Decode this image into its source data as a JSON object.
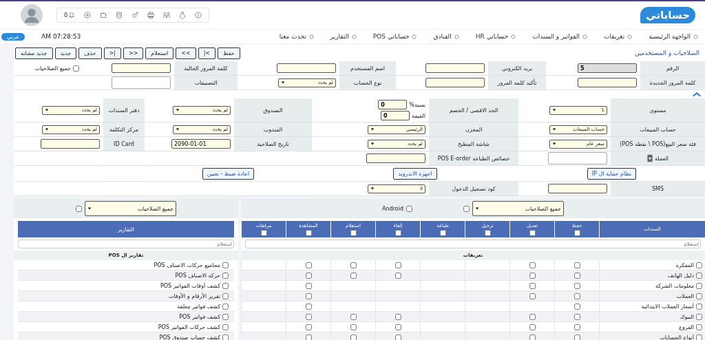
{
  "header": {
    "logo": "حساباتي",
    "notifications_count": "0"
  },
  "nav": {
    "items": [
      "الواجهة الرئيسية",
      "تعريفات",
      "الفواتير و السندات",
      "حساباتي HR",
      "الفنادق",
      "حساباتي POS",
      "التقارير",
      "تحدث معنا"
    ],
    "time": "AM 07:28:53",
    "language": "عربي"
  },
  "page_title": "الصلاحيات و المستخدمين",
  "actions": [
    "حفظ",
    "|<",
    "<<",
    "استعلام",
    ">>",
    ">|",
    "حذف",
    "جديد",
    "جديد مشابه"
  ],
  "account": {
    "rows": [
      [
        {
          "label": "الرقم",
          "field": {
            "kind": "readonly",
            "value": "5"
          }
        },
        {
          "label": "بريد الكتروني",
          "field": {
            "kind": "input"
          }
        },
        {
          "label": "اسم المستخدم",
          "field": {
            "kind": "input"
          }
        },
        {
          "label": "كلمة المرور الحالية",
          "field": {
            "kind": "input"
          }
        },
        {
          "label": "جميع الصلاحيات",
          "field": {
            "kind": "checkbox",
            "checked": false
          }
        }
      ],
      [
        {
          "label": "كلمة المرور الجديدة",
          "field": {
            "kind": "input"
          }
        },
        {
          "label": "تأكيد كلمة المرور",
          "field": {
            "kind": "input"
          }
        },
        {
          "label": "نوع الحساب",
          "field": {
            "kind": "select",
            "value": "لم يحدد"
          }
        },
        {
          "label": "التصنيفات",
          "field": {
            "kind": "plain"
          }
        },
        {
          "kind": "empty"
        }
      ]
    ]
  },
  "settings": {
    "rows": [
      [
        {
          "label": "مستوى",
          "field": {
            "kind": "select",
            "value": "1"
          }
        },
        {
          "label": "الحد الاقصى / الخصم",
          "field": {
            "kind": "pair",
            "items": [
              {
                "label": "نسبة%",
                "value": "0"
              },
              {
                "label": "القيمة",
                "value": "0"
              }
            ]
          }
        },
        {
          "label": "الصندوق",
          "field": {
            "kind": "select",
            "value": "لم يحدد"
          }
        },
        {
          "label": "دفتر السندات",
          "field": {
            "kind": "select",
            "value": "لم يحدد"
          }
        }
      ],
      [
        {
          "label": "حساب المبيعات",
          "field": {
            "kind": "select",
            "value": "حساب المبيعات"
          }
        },
        {
          "label": "المخزن",
          "field": {
            "kind": "select",
            "value": "الرئيسي"
          }
        },
        {
          "label": "المندوب",
          "field": {
            "kind": "select",
            "value": "لم يحدد"
          }
        },
        {
          "label": "مركز التكلفة",
          "field": {
            "kind": "select",
            "value": "لم يحدد"
          }
        }
      ],
      [
        {
          "label": "فئة سعر البيع(POS \\ نقطة POS)",
          "field": {
            "kind": "select",
            "value": "سعر عام"
          }
        },
        {
          "label": "شاشة المطبخ",
          "field": {
            "kind": "select",
            "value": "لم يحدد"
          }
        },
        {
          "label": "تاريخ الصلاحية",
          "field": {
            "kind": "input",
            "value": "2090-01-01"
          }
        },
        {
          "label": "ID Card",
          "field": {
            "kind": "input"
          }
        }
      ],
      [
        {
          "label": "العملة",
          "kind": "icon-label",
          "field": {
            "kind": "plain"
          }
        },
        {
          "label": "خصائص الطباعة POS E-order",
          "field": {
            "kind": "input"
          }
        },
        {
          "kind": "empty"
        },
        {
          "kind": "empty"
        }
      ],
      [
        {
          "field": {
            "kind": "button",
            "label": "نظام حماية ال IP"
          }
        },
        {
          "field": {
            "kind": "button",
            "label": "اجهزة الاندرويد"
          }
        },
        {
          "field": {
            "kind": "button",
            "label": "اعادة ضبط - تعيين"
          }
        },
        {
          "kind": "empty"
        }
      ],
      [
        {
          "label": "SMS",
          "field": {
            "kind": "input"
          }
        },
        {
          "label": "كود تسجيل الدخول",
          "field": {
            "kind": "select",
            "value": "لا"
          }
        },
        {
          "kind": "empty"
        },
        {
          "kind": "empty"
        }
      ]
    ]
  },
  "vouchers_panel": {
    "filter": "جميع الصلاحيات",
    "all_checked": false,
    "android": {
      "label": "Android",
      "checked": false
    },
    "columns": [
      {
        "label": "السندات"
      },
      {
        "label": "حفظ",
        "checked": false
      },
      {
        "label": "تعديل",
        "checked": false
      },
      {
        "label": "ترحيل",
        "checked": false
      },
      {
        "label": "طباعة",
        "checked": false
      },
      {
        "label": "إلغاء",
        "checked": false
      },
      {
        "label": "استعلام",
        "checked": false
      },
      {
        "label": "المشاهدة",
        "checked": false
      },
      {
        "label": "مرفقات",
        "checked": false
      }
    ],
    "search_placeholder": "استعلام",
    "section": "تعريفات",
    "rows": [
      {
        "name": "المفكرة",
        "checked": false,
        "cells": [
          {
            "kind": "checkbox",
            "checked": false
          },
          {
            "kind": "checkbox",
            "checked": false
          },
          {
            "kind": "none"
          },
          {
            "kind": "none"
          },
          {
            "kind": "checkbox",
            "checked": false
          },
          {
            "kind": "checkbox",
            "checked": false
          },
          {
            "kind": "checkbox",
            "checked": false
          },
          {
            "kind": "none"
          }
        ]
      },
      {
        "name": "دليل الهاتف",
        "checked": false,
        "cells": [
          {
            "kind": "checkbox",
            "checked": false
          },
          {
            "kind": "checkbox",
            "checked": false
          },
          {
            "kind": "none"
          },
          {
            "kind": "none"
          },
          {
            "kind": "checkbox",
            "checked": false
          },
          {
            "kind": "checkbox",
            "checked": false
          },
          {
            "kind": "checkbox",
            "checked": false
          },
          {
            "kind": "none"
          }
        ]
      },
      {
        "name": "معلومات الشركة",
        "checked": false,
        "cells": [
          {
            "kind": "checkbox",
            "checked": false
          },
          {
            "kind": "checkbox",
            "checked": false
          },
          {
            "kind": "none"
          },
          {
            "kind": "none"
          },
          {
            "kind": "none"
          },
          {
            "kind": "none"
          },
          {
            "kind": "checkbox",
            "checked": false
          },
          {
            "kind": "none"
          }
        ]
      },
      {
        "name": "العملات",
        "checked": false,
        "cells": [
          {
            "kind": "checkbox",
            "checked": false
          },
          {
            "kind": "checkbox",
            "checked": false
          },
          {
            "kind": "none"
          },
          {
            "kind": "none"
          },
          {
            "kind": "none"
          },
          {
            "kind": "none"
          },
          {
            "kind": "checkbox",
            "checked": false
          },
          {
            "kind": "none"
          }
        ]
      },
      {
        "name": "أسعار العملات الابتدائية",
        "checked": false,
        "cells": [
          {
            "kind": "checkbox",
            "checked": false
          },
          {
            "kind": "none"
          },
          {
            "kind": "none"
          },
          {
            "kind": "none"
          },
          {
            "kind": "none"
          },
          {
            "kind": "none"
          },
          {
            "kind": "checkbox",
            "checked": false
          },
          {
            "kind": "none"
          }
        ]
      },
      {
        "name": "البنوك",
        "checked": false,
        "cells": [
          {
            "kind": "checkbox",
            "checked": false
          },
          {
            "kind": "checkbox",
            "checked": false
          },
          {
            "kind": "none"
          },
          {
            "kind": "none"
          },
          {
            "kind": "checkbox",
            "checked": false
          },
          {
            "kind": "checkbox",
            "checked": false
          },
          {
            "kind": "checkbox",
            "checked": false
          },
          {
            "kind": "none"
          }
        ]
      },
      {
        "name": "الفروع",
        "checked": false,
        "cells": [
          {
            "kind": "checkbox",
            "checked": false
          },
          {
            "kind": "checkbox",
            "checked": false
          },
          {
            "kind": "none"
          },
          {
            "kind": "none"
          },
          {
            "kind": "checkbox",
            "checked": false
          },
          {
            "kind": "checkbox",
            "checked": false
          },
          {
            "kind": "checkbox",
            "checked": false
          },
          {
            "kind": "none"
          }
        ]
      },
      {
        "name": "أنواع الحسابات",
        "checked": false,
        "cells": [
          {
            "kind": "checkbox",
            "checked": false
          },
          {
            "kind": "checkbox",
            "checked": false
          },
          {
            "kind": "none"
          },
          {
            "kind": "none"
          },
          {
            "kind": "checkbox",
            "checked": false
          },
          {
            "kind": "checkbox",
            "checked": false
          },
          {
            "kind": "checkbox",
            "checked": false
          },
          {
            "kind": "none"
          }
        ]
      }
    ]
  },
  "reports_panel": {
    "filter": "جميع الصلاحيات",
    "all_checked": false,
    "title": "التقارير",
    "search_placeholder": "استعلام",
    "section": "تقارير ال POS",
    "items": [
      {
        "label": "مجاميع حركات الاصناف POS",
        "checked": false
      },
      {
        "label": "حركة الاصناف POS",
        "checked": false
      },
      {
        "label": "كشف أوقات الفواتير POS",
        "checked": false
      },
      {
        "label": "تقرير الأرقام و الأوقات",
        "checked": false
      },
      {
        "label": "كشف فواتير معلقة",
        "checked": false
      },
      {
        "label": "كشف فواتير POS",
        "checked": false
      },
      {
        "label": "كشف حركات الفواتير POS",
        "checked": false
      },
      {
        "label": "كشف حساب صندوق POS",
        "checked": false
      }
    ]
  }
}
